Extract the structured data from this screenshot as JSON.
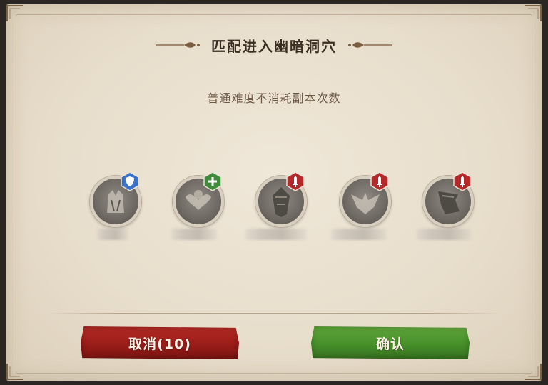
{
  "dialog": {
    "title": "匹配进入幽暗洞穴",
    "subtitle": "普通难度不消耗副本次数"
  },
  "party": {
    "members": [
      {
        "role_icon": "shield-icon",
        "role_color": "#3a72c8",
        "portrait_icon": "hero-portrait-icon"
      },
      {
        "role_icon": "plus-icon",
        "role_color": "#3f8a3a",
        "portrait_icon": "hero-portrait-icon"
      },
      {
        "role_icon": "sword-icon",
        "role_color": "#b42a2a",
        "portrait_icon": "hero-portrait-icon"
      },
      {
        "role_icon": "sword-icon",
        "role_color": "#b42a2a",
        "portrait_icon": "hero-portrait-icon"
      },
      {
        "role_icon": "sword-icon",
        "role_color": "#b42a2a",
        "portrait_icon": "hero-portrait-icon"
      }
    ]
  },
  "buttons": {
    "cancel_label": "取消(10)",
    "confirm_label": "确认"
  }
}
